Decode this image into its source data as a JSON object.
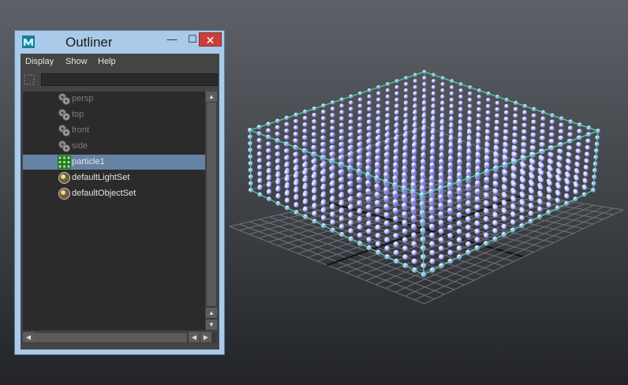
{
  "window": {
    "title": "Outliner",
    "minimize_glyph": "—",
    "maximize_glyph": "☐",
    "close_glyph": "✕"
  },
  "menu": [
    "Display",
    "Show",
    "Help"
  ],
  "filter": {
    "value": ""
  },
  "outliner_items": [
    {
      "label": "persp",
      "icon": "camera-icon",
      "state": "dim"
    },
    {
      "label": "top",
      "icon": "camera-icon",
      "state": "dim"
    },
    {
      "label": "front",
      "icon": "camera-icon",
      "state": "dim"
    },
    {
      "label": "side",
      "icon": "camera-icon",
      "state": "dim"
    },
    {
      "label": "particle1",
      "icon": "particle-icon",
      "state": "selected"
    },
    {
      "label": "defaultLightSet",
      "icon": "set-icon",
      "state": "normal"
    },
    {
      "label": "defaultObjectSet",
      "icon": "set-icon",
      "state": "normal"
    }
  ],
  "scrollbar_glyphs": {
    "up": "▲",
    "down": "▼",
    "left": "◀",
    "right": "▶"
  },
  "colors": {
    "window_frame": "#a9cbe9",
    "selection": "#6683a6",
    "bounding_box": "#4fd9a8",
    "particle": "#bcc0ff",
    "close_button": "#c9403b"
  }
}
